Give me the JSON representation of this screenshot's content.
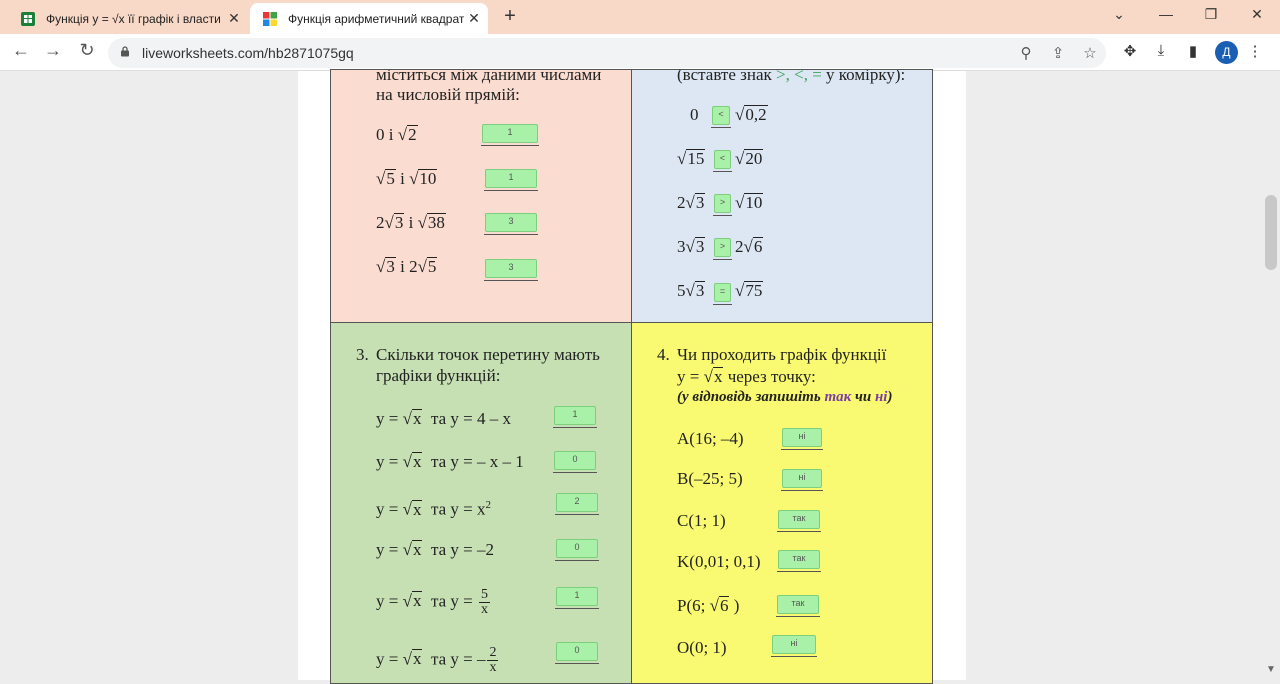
{
  "browser": {
    "tabs": [
      {
        "title": "Функція y = √x її графік і власти",
        "favicon": "sheets-icon",
        "color": "#188038"
      },
      {
        "title": "Функція арифметичний квадрат",
        "favicon": "liveworksheets-icon",
        "color": "#e53935"
      }
    ],
    "url": "liveworksheets.com/hb2871075gq",
    "avatar": "Д"
  },
  "q1": {
    "header_1": "міститься між даними числами",
    "header_2": "на числовій прямій:",
    "items": [
      {
        "a": "0",
        "b": "2",
        "answer": "1"
      },
      {
        "a": "5",
        "b": "10",
        "answer": "1"
      },
      {
        "a": "2",
        "b": "38",
        "answer": "3"
      },
      {
        "a": "3",
        "b": "2",
        "answer": "3"
      }
    ],
    "and": "і",
    "coef_2": "2",
    "radicand_3": "3",
    "radicand_5": "5"
  },
  "q2": {
    "header": "(вставте знак",
    "signs": ">, <, =",
    "header_end": "у комірку):",
    "rows": [
      {
        "left": "0",
        "left_root": "",
        "answer": "<",
        "right_coef": "",
        "right_root": "0,2"
      },
      {
        "left": "",
        "left_root": "15",
        "answer": "<",
        "right_coef": "",
        "right_root": "20"
      },
      {
        "left": "2",
        "left_root": "3",
        "answer": ">",
        "right_coef": "",
        "right_root": "10"
      },
      {
        "left": "3",
        "left_root": "3",
        "answer": ">",
        "right_coef": "2",
        "right_root": "6"
      },
      {
        "left": "5",
        "left_root": "3",
        "answer": "=",
        "right_coef": "",
        "right_root": "75"
      }
    ]
  },
  "q3": {
    "number": "3.",
    "title_1": "Скільки точок перетину мають",
    "title_2": "графіки функцій:",
    "prefix": "y =",
    "sqrt_arg": "x",
    "mid": "та y =",
    "rows": [
      {
        "rhs": "4 – x",
        "answer": "1"
      },
      {
        "rhs": "– x – 1",
        "answer": "0"
      },
      {
        "rhs": "x",
        "sup": "2",
        "answer": "2"
      },
      {
        "rhs": "–2",
        "answer": "0"
      },
      {
        "rhs": "",
        "num": "5",
        "den": "x",
        "answer": "1"
      },
      {
        "rhs": "–",
        "num": "2",
        "den": "x",
        "answer": "0"
      }
    ]
  },
  "q4": {
    "number": "4.",
    "title_1": "Чи проходить графік функції",
    "title_2a": "y =",
    "title_2b": "x",
    "title_2c": "через точку:",
    "hint_a": "(у відповідь запишіть",
    "hint_yes": "так",
    "hint_or": "чи",
    "hint_no": "ні",
    "hint_end": ")",
    "points": [
      {
        "label": "A(16; –4)",
        "answer": "ні"
      },
      {
        "label": "B(–25; 5)",
        "answer": "ні"
      },
      {
        "label": "C(1; 1)",
        "answer": "так"
      },
      {
        "label": "K(0,01; 0,1)",
        "answer": "так"
      },
      {
        "label_a": "P(6;",
        "root": "6",
        "label_b": ")",
        "answer": "так"
      },
      {
        "label": "O(0; 1)",
        "answer": "ні"
      }
    ]
  }
}
